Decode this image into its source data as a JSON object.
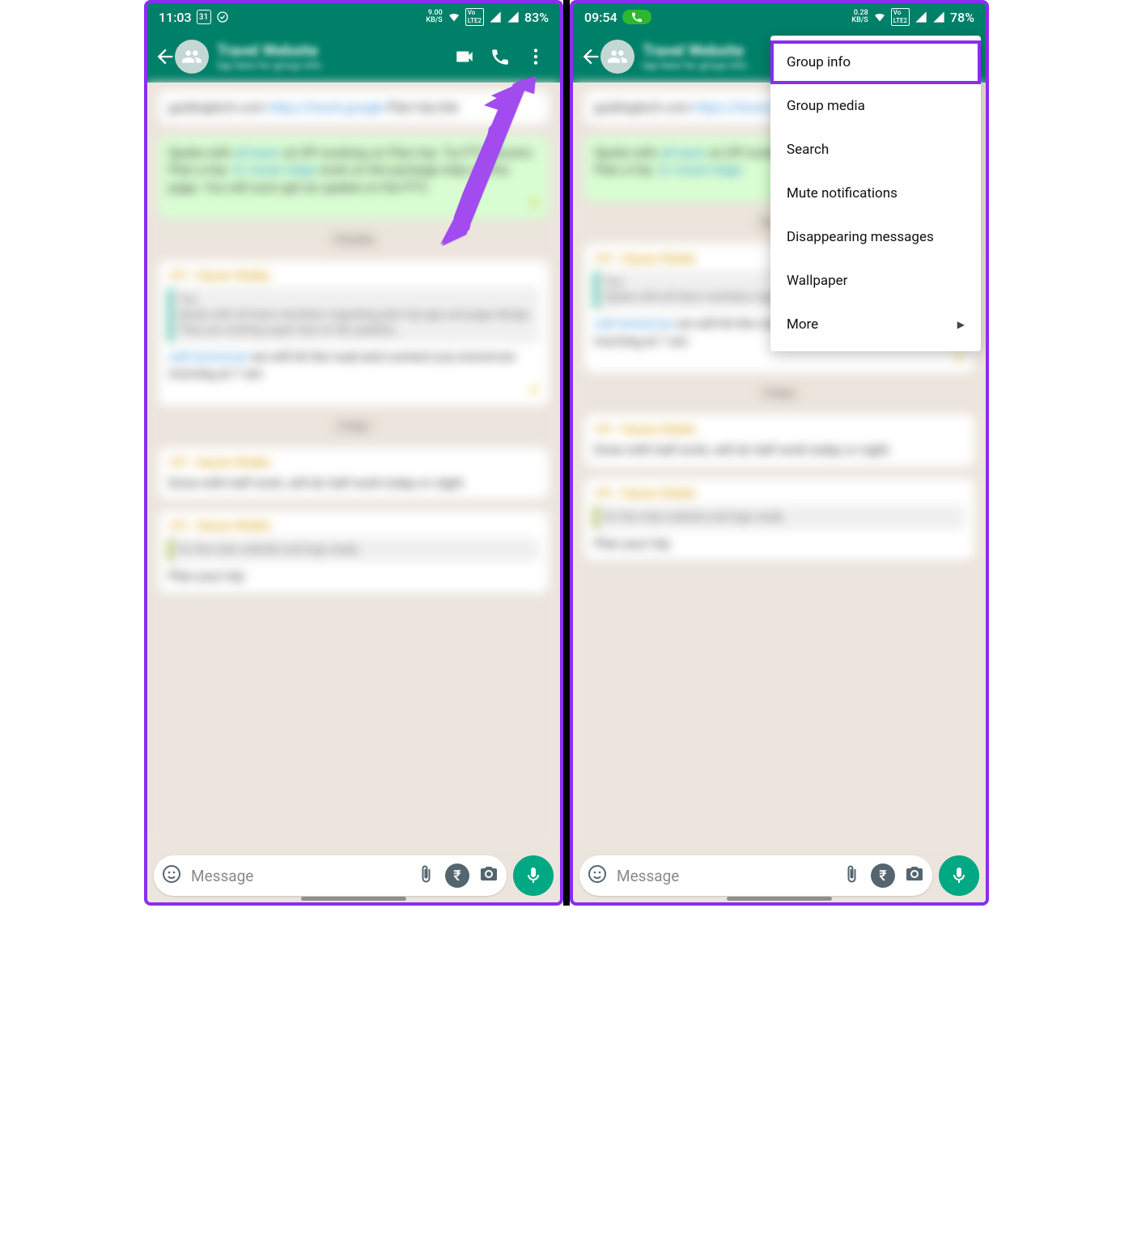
{
  "left": {
    "status": {
      "time": "11:03",
      "date_num": "31",
      "data_rate": "9.00",
      "data_unit": "KB/S",
      "lte": "LTE 2",
      "battery": "83%"
    },
    "header": {
      "title": "Travel Website",
      "subtitle": "tap here for group info"
    },
    "input": {
      "placeholder": "Message",
      "rupee": "₹"
    }
  },
  "right": {
    "status": {
      "time": "09:54",
      "data_rate": "0.28",
      "data_unit": "KB/S",
      "lte": "LTE 2",
      "battery": "78%"
    },
    "header": {
      "title": "Travel Website",
      "subtitle": "tap here for group info"
    },
    "input": {
      "placeholder": "Message",
      "rupee": "₹"
    },
    "menu": {
      "items": [
        "Group info",
        "Group media",
        "Search",
        "Mute notifications",
        "Disappearing messages",
        "Wallpaper",
        "More"
      ]
    }
  }
}
